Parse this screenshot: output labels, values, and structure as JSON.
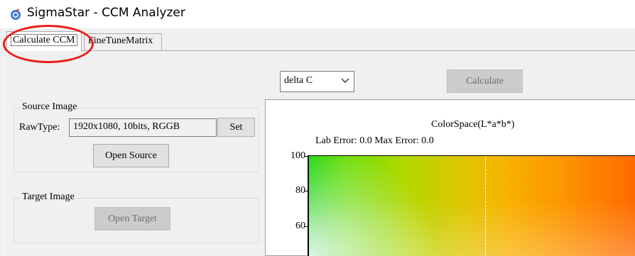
{
  "window": {
    "title": "SigmaStar - CCM Analyzer",
    "icon": "app-globe-icon"
  },
  "tabs": [
    {
      "label": "Calculate CCM",
      "active": true
    },
    {
      "label": "FineTuneMatrix",
      "active": false
    }
  ],
  "toolbar": {
    "mode_select": {
      "value": "delta C"
    },
    "calculate_label": "Calculate"
  },
  "source": {
    "group_label": "Source Image",
    "rawtype_label": "RawType:",
    "rawtype_value": "1920x1080, 10bits, RGGB",
    "set_label": "Set",
    "open_label": "Open Source"
  },
  "target": {
    "group_label": "Target Image",
    "open_label": "Open Target"
  },
  "chart_data": {
    "type": "heatmap",
    "title": "ColorSpace(L*a*b*)",
    "subtitle": "Lab Error: 0.0 Max Error: 0.0",
    "yticks": [
      "100",
      "80",
      "60"
    ]
  },
  "colors": {
    "annotation": "#e8201b",
    "accent": "#0fd400"
  }
}
